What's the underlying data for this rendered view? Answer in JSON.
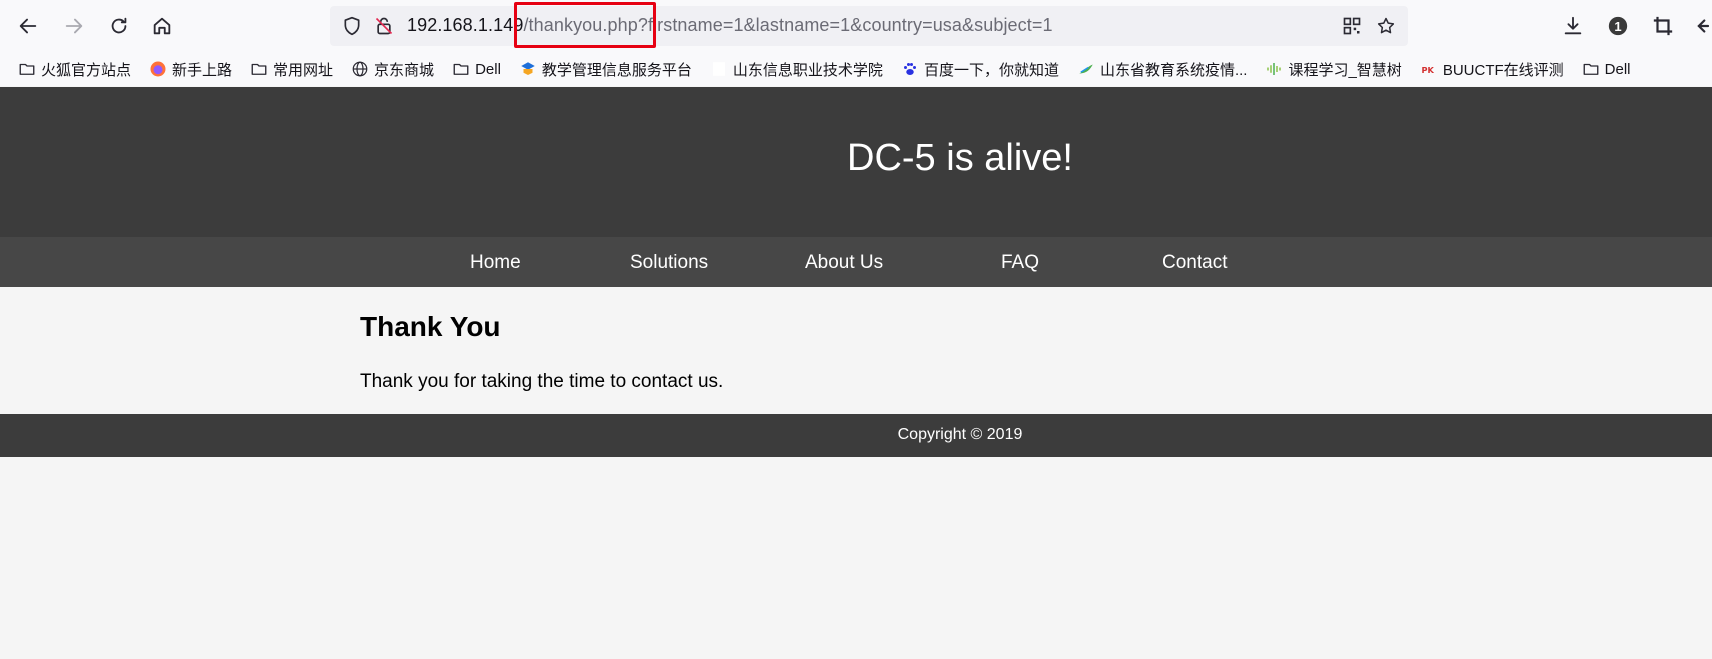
{
  "browser": {
    "url_host": "192.168.1.14",
    "url_tail_hidden": "9",
    "url_path": "/thankyou.php?",
    "url_query": "firstname=1&lastname=1&country=usa&subject=1",
    "extension_badge": "1"
  },
  "bookmarks": [
    {
      "label": "火狐官方站点",
      "icon": "folder-icon"
    },
    {
      "label": "新手上路",
      "icon": "firefox-icon"
    },
    {
      "label": "常用网址",
      "icon": "folder-icon"
    },
    {
      "label": "京东商城",
      "icon": "globe-icon"
    },
    {
      "label": "Dell",
      "icon": "folder-icon"
    },
    {
      "label": "教学管理信息服务平台",
      "icon": "site-icon"
    },
    {
      "label": "山东信息职业技术学院",
      "icon": "blank-page-icon"
    },
    {
      "label": "百度一下，你就知道",
      "icon": "baidu-paw-icon"
    },
    {
      "label": "山东省教育系统疫情...",
      "icon": "site-icon"
    },
    {
      "label": "课程学习_智慧树",
      "icon": "site-icon"
    },
    {
      "label": "BUUCTF在线评测",
      "icon": "site-icon"
    },
    {
      "label": "Dell",
      "icon": "folder-icon"
    }
  ],
  "site": {
    "title": "DC-5 is alive!",
    "nav": [
      "Home",
      "Solutions",
      "About Us",
      "FAQ",
      "Contact"
    ],
    "heading": "Thank You",
    "message": "Thank you for taking the time to contact us.",
    "footer": "Copyright © 2019"
  },
  "colors": {
    "header_bg": "#3c3c3c",
    "nav_bg": "#474747",
    "page_bg": "#f5f5f5",
    "highlight_box": "#e60012"
  }
}
